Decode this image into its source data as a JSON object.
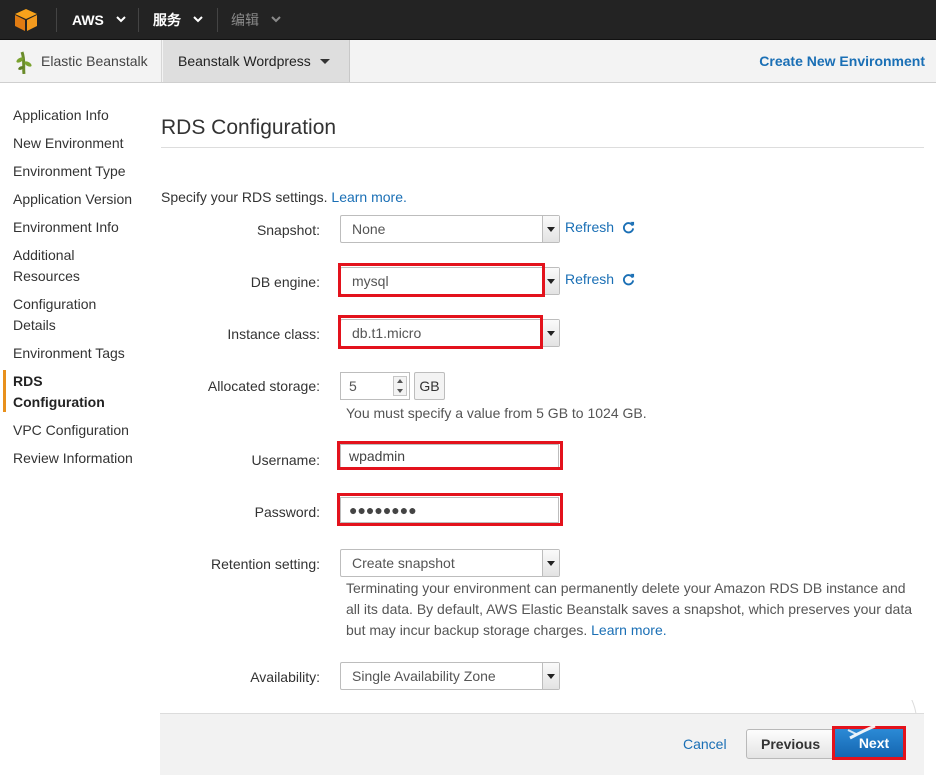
{
  "topbar": {
    "aws_label": "AWS",
    "services_label": "服务",
    "edit_label": "编辑"
  },
  "subbar": {
    "brand_label": "Elastic Beanstalk",
    "app_label": "Beanstalk Wordpress",
    "create_env_label": "Create New Environment"
  },
  "sidebar": {
    "items": [
      "Application Info",
      "New Environment",
      "Environment Type",
      "Application Version",
      "Environment Info",
      "Additional Resources",
      "Configuration Details",
      "Environment Tags",
      "RDS Configuration",
      "VPC Configuration",
      "Review Information"
    ],
    "active": "RDS Configuration"
  },
  "main": {
    "title": "RDS Configuration",
    "intro_text": "Specify your RDS settings. ",
    "intro_link": "Learn more.",
    "refresh_label": "Refresh",
    "fields": {
      "snapshot": {
        "label": "Snapshot:",
        "value": "None"
      },
      "db_engine": {
        "label": "DB engine:",
        "value": "mysql"
      },
      "instance_class": {
        "label": "Instance class:",
        "value": "db.t1.micro"
      },
      "allocated_storage": {
        "label": "Allocated storage:",
        "value": "5",
        "unit": "GB",
        "help": "You must specify a value from 5 GB to 1024 GB."
      },
      "username": {
        "label": "Username:",
        "value": "wpadmin"
      },
      "password": {
        "label": "Password:",
        "value": "●●●●●●●●"
      },
      "retention": {
        "label": "Retention setting:",
        "value": "Create snapshot",
        "help_line1": "Terminating your environment can permanently delete your Amazon RDS DB instance and",
        "help_line2": "all its data. By default, AWS Elastic Beanstalk saves a snapshot, which preserves your data",
        "help_line3": "but may incur backup storage charges. ",
        "help_link": "Learn more."
      },
      "availability": {
        "label": "Availability:",
        "value": "Single Availability Zone"
      }
    }
  },
  "footer": {
    "cancel_label": "Cancel",
    "previous_label": "Previous",
    "next_label": "Next"
  },
  "colors": {
    "topbar": "#232323",
    "link": "#1a6fb5",
    "highlight": "#e3121c",
    "active_marker": "#e8901c",
    "primary_button": "#1566b0"
  }
}
